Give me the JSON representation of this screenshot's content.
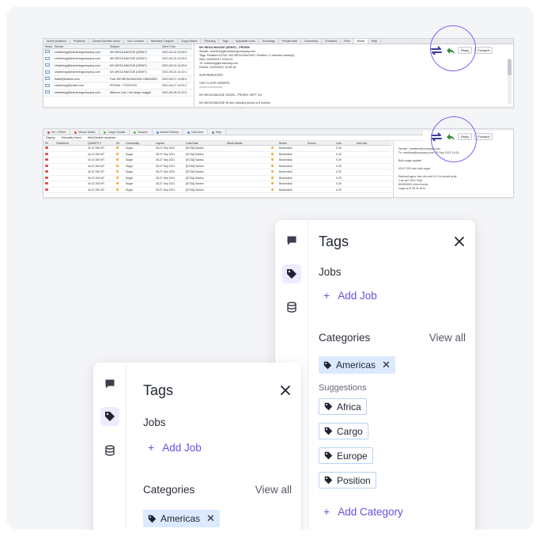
{
  "shot1": {
    "tabs": [
      "Active positions",
      "Positions",
      "Owner/Operator Inbox",
      "Voc Contract",
      "Standard Cargoes",
      "Cargo Match",
      "Planning",
      "Tags",
      "Specialist Lines",
      "Exchange",
      "Private Mail",
      "Comments",
      "Portfolios",
      "Files",
      "Email",
      "Help"
    ],
    "columns": [
      "Read",
      "Sender",
      "Subject",
      "Sent From"
    ],
    "rows": [
      {
        "sender": "chartering@charteringcompany.com",
        "subject": "MV MEGA MAGGIE (DEMIT)",
        "date": "2021-09-24 14:09:2"
      },
      {
        "sender": "chartering@charteringcompany.com",
        "subject": "MV MEGA MAGGIE (DEMIT)",
        "date": "2021-09-24 14:09:4"
      },
      {
        "sender": "chartering@charteringcompany.com",
        "subject": "MV MEGA MAGGIE (DEMIT)",
        "date": "2021-09-24 14:09:5"
      },
      {
        "sender": "chartering@charteringcompany.com",
        "subject": "MV MEGA MAGGIE (DEMIT)",
        "date": "2021-09-24 14:10:1"
      },
      {
        "sender": "trade@brokers.com",
        "subject": "Fwd: MV MEGA MAGGIE ONBOARD",
        "date": "2021-09-27 11:06:3"
      },
      {
        "sender": "chartering@broker.com",
        "subject": "PROEM - POSITION",
        "date": "2021-09-27 13:02:2"
      },
      {
        "sender": "chartering@charteringcompany.com",
        "subject": "Balticon Line / Vec shipp maggie",
        "date": "2021-09-28 10:10:2"
      }
    ],
    "preview_lines": [
      "MV MEGA MAGGIE (DEMIT) - PROEM",
      "Sender: chartering@charteringcompany.com",
      "Tags: Positions ECSA / MV MEGA MAGGIE / Position / 1 selected vessel(s)",
      "Sent: 24/09/2021 10:59:23",
      "To: chartering@brokerbay.com",
      "Posted: 24/09/2021 10:59:18",
      "",
      "SUPERBROKERS",
      "",
      "OUR CLOSE OWNERS",
      "==============",
      "",
      "MV MEGA MAGGIE 100000 - PROEM: SEPT 3/4",
      "",
      "MV MEGA MAGGIE 95 dwt, included period of 6 months"
    ],
    "toolbar": {
      "reply": "Reply",
      "forward": "Forward"
    }
  },
  "shot2": {
    "tabs": [
      "Vm / Offers",
      "Vessel Match",
      "Cargo Details",
      "Vessels",
      "Market History",
      "Overview",
      "Help"
    ],
    "filter": {
      "display": "Display",
      "manually": "Manually linked",
      "hide_dup": "Hide/Disable duplicate"
    },
    "columns": [
      "Pri",
      "Charterers",
      "QUANTITY",
      "Dir",
      "Commodity",
      "Laycan",
      "Load Date",
      "Stack Master",
      "",
      "Broker",
      "Source",
      "Com",
      "Add.com"
    ],
    "rows": [
      {
        "qty": "40-47,000 MT",
        "com": "Sugar",
        "laycan": "28-27 Sep 2021",
        "load": "[ECSA] Santos",
        "broker": "Brokerclick",
        "c": "0.25"
      },
      {
        "qty": "40-47,000 MT",
        "com": "Sugar",
        "laycan": "28-27 Sep 2021",
        "load": "[ECSA] Santos",
        "broker": "Brokerclick",
        "c": "0.25"
      },
      {
        "qty": "40-47,000 MT",
        "com": "Sugar",
        "laycan": "28-27 Sep 2021",
        "load": "[ECSA] Santos",
        "broker": "Brokerclick",
        "c": "0.25"
      },
      {
        "qty": "40-47,000 MT",
        "com": "Sugar",
        "laycan": "28-27 Sep 2021",
        "load": "[ECSA] Santos",
        "broker": "Brokerclick",
        "c": "0.25"
      },
      {
        "qty": "40-47,000 MT",
        "com": "Sugar",
        "laycan": "28-27 Sep 2021",
        "load": "[ECSA] Santos",
        "broker": "Brokerclick",
        "c": "0.25"
      },
      {
        "qty": "40-47,000 MT",
        "com": "Sugar",
        "laycan": "28-27 Sep 2021",
        "load": "[ECSA] Santos",
        "broker": "Brokerclick",
        "c": "0.25"
      },
      {
        "qty": "40-47,000 MT",
        "com": "Sugar",
        "laycan": "28-27 Sep 2021",
        "load": "[ECSA] Santos",
        "broker": "Brokerclick",
        "c": "0.25"
      },
      {
        "qty": "40-47,000 MT",
        "com": "Sugar",
        "laycan": "28-27 Sep 2021",
        "load": "[ECSA] Santos",
        "broker": "Brokerclick",
        "c": "0.25"
      }
    ],
    "preview_lines": [
      "Sender: maritime@company.com",
      "To: maritime@company.com    22 Sep 2021 11:05",
      "",
      "Bulk sugar update",
      "",
      "43/47 000 mts bulk sugar",
      "",
      "Santos/Lagos: free dis and 11.0 to arrival draft",
      "1 as per 2021 Sept",
      "6000/5000 shinc bunds",
      "sugar rp 8 25 W term"
    ],
    "toolbar": {
      "reply": "Reply",
      "forward": "Forward"
    }
  },
  "panel": {
    "title": "Tags",
    "jobs_title": "Jobs",
    "add_job": "Add Job",
    "categories_title": "Categories",
    "view_all": "View all",
    "selected_chip": "Americas",
    "suggestions_label": "Suggestions",
    "suggestions": [
      "Africa",
      "Cargo",
      "Europe",
      "Position"
    ],
    "add_category": "Add Category"
  },
  "colors": {
    "accent": "#6b4fe0",
    "chip_bg": "#dbeaff",
    "chip_border": "#b9d2f4",
    "ring": "#7b61ff"
  }
}
